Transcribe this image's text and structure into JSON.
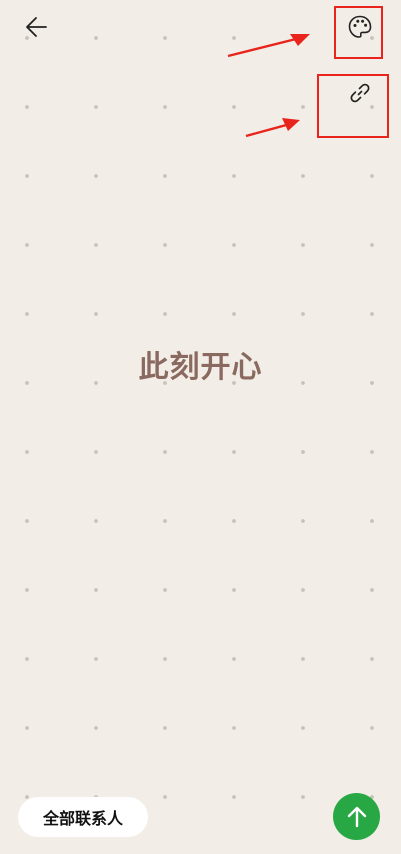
{
  "header": {
    "back_icon": "arrow-left-icon",
    "palette_icon": "palette-icon",
    "link_icon": "link-icon"
  },
  "content": {
    "status_text": "此刻开心"
  },
  "footer": {
    "contacts_label": "全部联系人",
    "send_icon": "arrow-up-icon"
  },
  "colors": {
    "background": "#f2ede6",
    "status_text": "#8a6a60",
    "annotation": "#e8241c",
    "send_button": "#27a845"
  }
}
